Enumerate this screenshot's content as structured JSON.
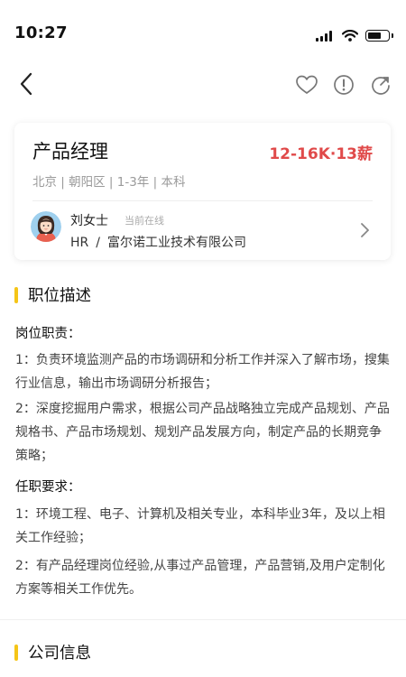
{
  "status_bar": {
    "time": "10:27"
  },
  "nav": {
    "back_icon": "chevron-left-icon",
    "actions": [
      "heart-icon",
      "info-icon",
      "share-icon"
    ]
  },
  "job": {
    "title": "产品经理",
    "salary": "12-16K·13薪",
    "meta": "北京 | 朝阳区 | 1-3年 | 本科",
    "recruiter": {
      "name": "刘女士",
      "status": "当前在线",
      "role": "HR",
      "separator": "/",
      "company": "富尔诺工业技术有限公司"
    }
  },
  "description": {
    "section_title": "职位描述",
    "duties_heading": "岗位职责：",
    "duties": [
      "1：负责环境监测产品的市场调研和分析工作并深入了解市场，搜集行业信息，输出市场调研分析报告；",
      "2：深度挖掘用户需求，根据公司产品战略独立完成产品规划、产品规格书、产品市场规划、规划产品发展方向，制定产品的长期竞争策略；"
    ],
    "requirements_heading": "任职要求：",
    "requirements": [
      "1：环境工程、电子、计算机及相关专业，本科毕业3年，及以上相关工作经验；",
      "2：有产品经理岗位经验,从事过产品管理，产品营销,及用户定制化方案等相关工作优先。"
    ]
  },
  "company_section": {
    "section_title": "公司信息"
  },
  "colors": {
    "accent_bar": "#f5c518",
    "salary": "#e04a4a",
    "meta_text": "#9a9a9a"
  }
}
